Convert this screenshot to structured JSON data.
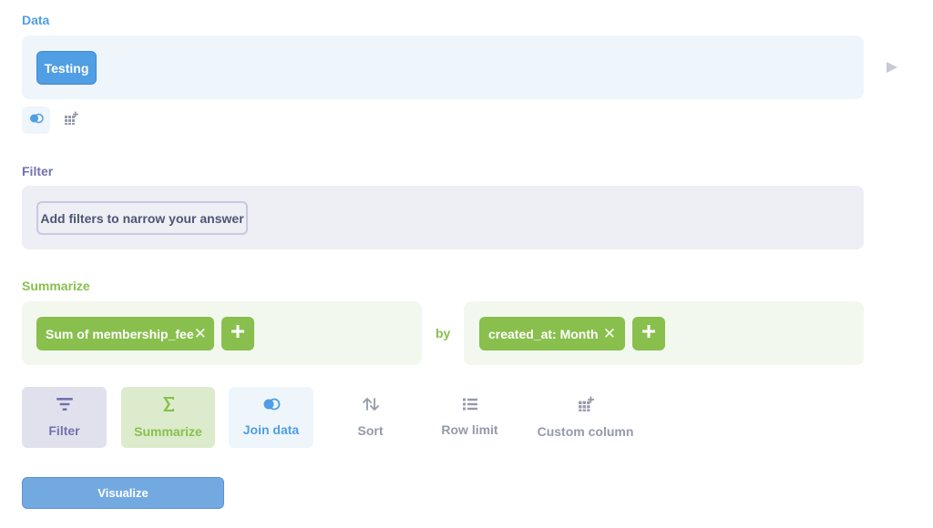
{
  "sections": {
    "data_label": "Data",
    "filter_label": "Filter",
    "summarize_label": "Summarize"
  },
  "data_step": {
    "source": "Testing"
  },
  "filter_step": {
    "placeholder": "Add filters to narrow your answer"
  },
  "summarize_step": {
    "aggregation": "Sum of membership_fee",
    "by_label": "by",
    "breakout": "created_at: Month"
  },
  "actions": [
    {
      "label": "Filter",
      "icon": "filter-icon"
    },
    {
      "label": "Summarize",
      "icon": "sigma-icon"
    },
    {
      "label": "Join data",
      "icon": "join-icon"
    },
    {
      "label": "Sort",
      "icon": "sort-icon"
    },
    {
      "label": "Row limit",
      "icon": "list-icon"
    },
    {
      "label": "Custom column",
      "icon": "add-column-icon"
    }
  ],
  "visualize_label": "Visualize",
  "colors": {
    "data": "#509ee3",
    "filter": "#7172ad",
    "summarize": "#88bf4d",
    "muted": "#949aab"
  }
}
